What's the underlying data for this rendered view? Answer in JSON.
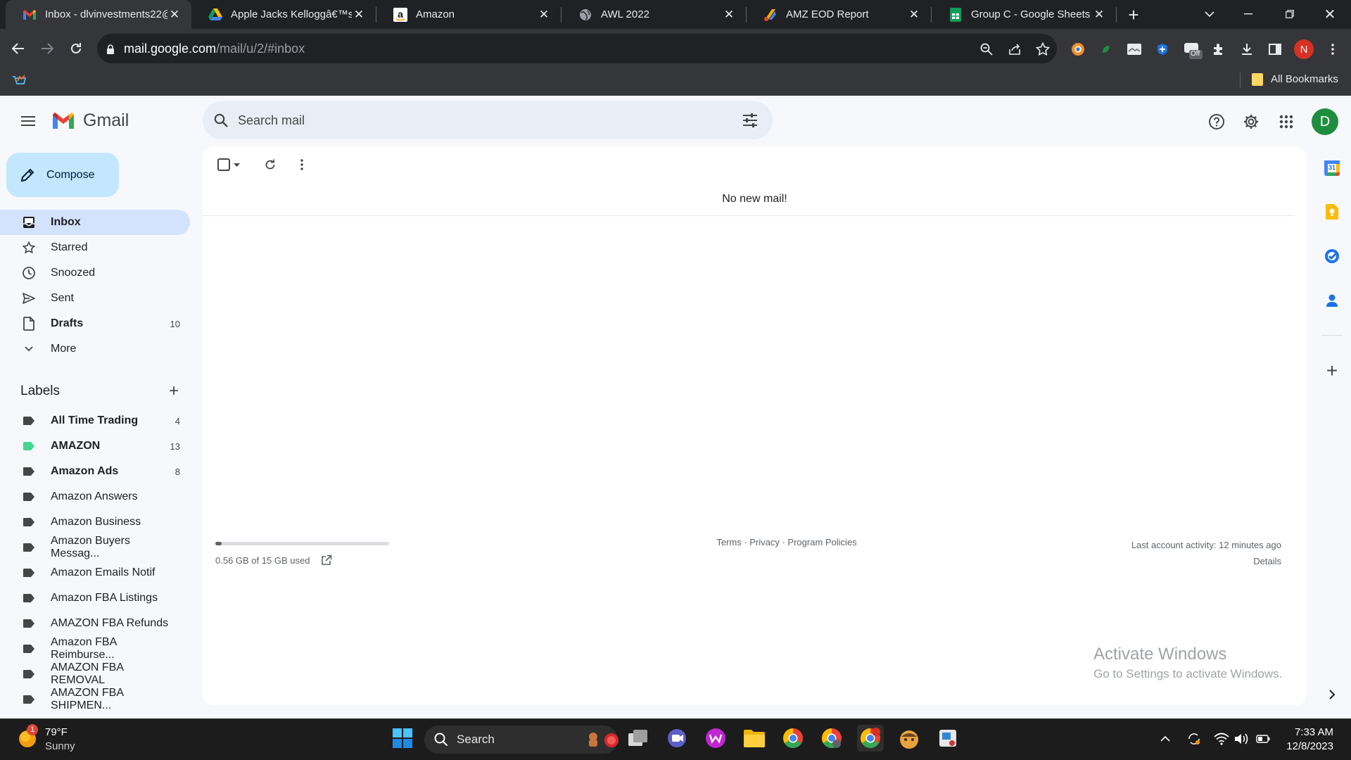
{
  "browser": {
    "tabs": [
      {
        "title": "Inbox - dlvinvestments22@",
        "icon": "gmail-icon",
        "active": true
      },
      {
        "title": "Apple Jacks Kelloggâ€™s B",
        "icon": "google-drive-icon"
      },
      {
        "title": "Amazon",
        "icon": "amazon-icon"
      },
      {
        "title": "AWL 2022",
        "icon": "globe-icon"
      },
      {
        "title": "AMZ EOD Report",
        "icon": "app-icon"
      },
      {
        "title": "Group C - Google Sheets",
        "icon": "sheets-icon"
      }
    ],
    "url_host": "mail.google.com",
    "url_path": "/mail/u/2/#inbox",
    "profile_initial": "N",
    "extension_badge": "Off",
    "bookmarks_label": "All Bookmarks"
  },
  "gmail": {
    "logo_text": "Gmail",
    "search_placeholder": "Search mail",
    "avatar_initial": "D",
    "compose_label": "Compose",
    "nav": [
      {
        "label": "Inbox",
        "icon": "inbox-icon",
        "count": "",
        "bold": true,
        "active": true
      },
      {
        "label": "Starred",
        "icon": "star-icon",
        "count": ""
      },
      {
        "label": "Snoozed",
        "icon": "clock-icon",
        "count": ""
      },
      {
        "label": "Sent",
        "icon": "send-icon",
        "count": ""
      },
      {
        "label": "Drafts",
        "icon": "draft-icon",
        "count": "10",
        "bold": true
      },
      {
        "label": "More",
        "icon": "chevron-down-icon",
        "count": ""
      }
    ],
    "labels_title": "Labels",
    "labels": [
      {
        "label": "All Time Trading",
        "count": "4",
        "bold": true,
        "color": "#444746"
      },
      {
        "label": "AMAZON",
        "count": "13",
        "bold": true,
        "color": "#43d692"
      },
      {
        "label": "Amazon Ads",
        "count": "8",
        "bold": true,
        "color": "#444746"
      },
      {
        "label": "Amazon Answers",
        "count": "",
        "color": "#444746"
      },
      {
        "label": "Amazon Business",
        "count": "",
        "color": "#444746"
      },
      {
        "label": "Amazon Buyers Messag...",
        "count": "",
        "color": "#444746"
      },
      {
        "label": "Amazon Emails Notif",
        "count": "",
        "color": "#444746"
      },
      {
        "label": "Amazon FBA Listings",
        "count": "",
        "color": "#444746"
      },
      {
        "label": "AMAZON FBA Refunds",
        "count": "",
        "color": "#444746"
      },
      {
        "label": "Amazon FBA Reimburse...",
        "count": "",
        "color": "#444746"
      },
      {
        "label": "AMAZON FBA REMOVAL",
        "count": "",
        "color": "#444746"
      },
      {
        "label": "AMAZON FBA SHIPMEN...",
        "count": "",
        "color": "#444746"
      }
    ],
    "empty_message": "No new mail!",
    "storage_text": "0.56 GB of 15 GB used",
    "storage_fraction": 0.037,
    "footer_links": "Terms · Privacy · Program Policies",
    "last_activity": "Last account activity: 12 minutes ago",
    "details_label": "Details",
    "calendar_date": "31"
  },
  "windows": {
    "activate_title": "Activate Windows",
    "activate_sub": "Go to Settings to activate Windows.",
    "weather_temp": "79°F",
    "weather_desc": "Sunny",
    "weather_badge": "1",
    "search_label": "Search",
    "time": "7:33 AM",
    "date": "12/8/2023"
  }
}
